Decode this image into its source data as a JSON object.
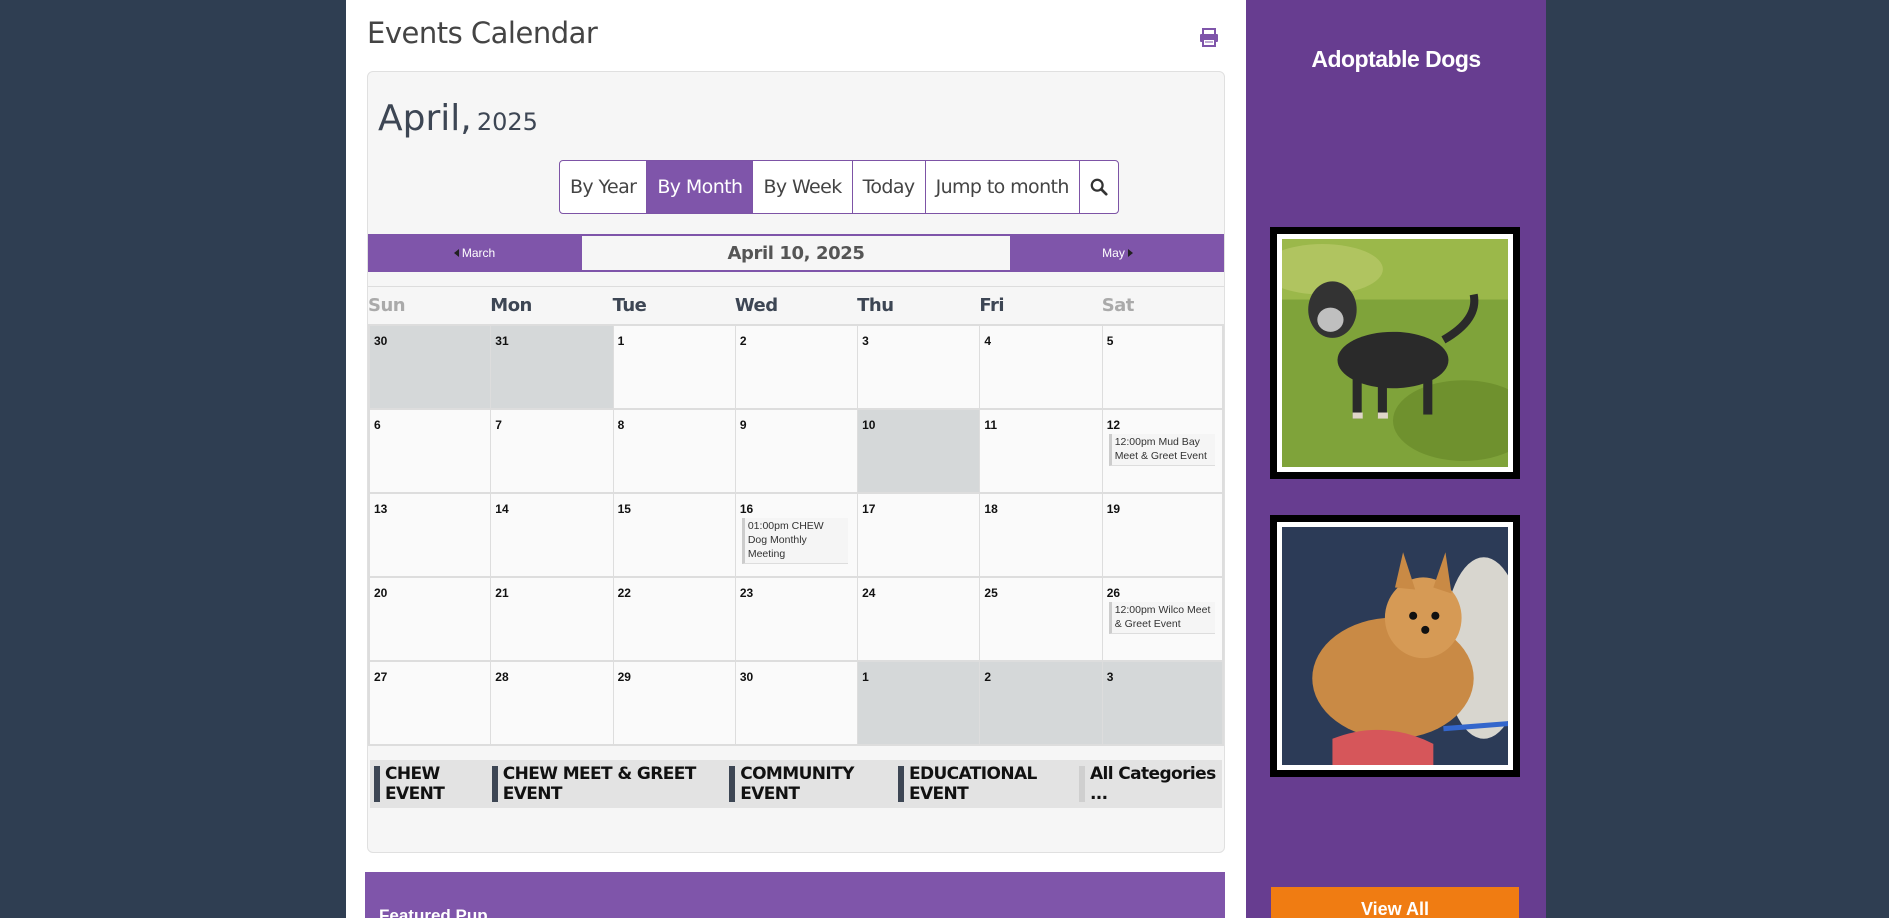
{
  "page": {
    "title": "Events Calendar"
  },
  "calendar": {
    "month": "April,",
    "year": "2025",
    "view_buttons": [
      "By Year",
      "By Month",
      "By Week",
      "Today",
      "Jump to month"
    ],
    "active_view": "By Month",
    "nav": {
      "prev": "March",
      "current": "April 10, 2025",
      "next": "May"
    },
    "weekdays": [
      "Sun",
      "Mon",
      "Tue",
      "Wed",
      "Thu",
      "Fri",
      "Sat"
    ],
    "weeks": [
      [
        {
          "num": "30",
          "type": "other"
        },
        {
          "num": "31",
          "type": "other"
        },
        {
          "num": "1"
        },
        {
          "num": "2"
        },
        {
          "num": "3"
        },
        {
          "num": "4"
        },
        {
          "num": "5"
        }
      ],
      [
        {
          "num": "6"
        },
        {
          "num": "7"
        },
        {
          "num": "8"
        },
        {
          "num": "9"
        },
        {
          "num": "10",
          "type": "today"
        },
        {
          "num": "11"
        },
        {
          "num": "12",
          "events": [
            "12:00pm Mud Bay Meet & Greet Event"
          ]
        }
      ],
      [
        {
          "num": "13"
        },
        {
          "num": "14"
        },
        {
          "num": "15"
        },
        {
          "num": "16",
          "events": [
            "01:00pm CHEW Dog Monthly Meeting"
          ]
        },
        {
          "num": "17"
        },
        {
          "num": "18"
        },
        {
          "num": "19"
        }
      ],
      [
        {
          "num": "20"
        },
        {
          "num": "21"
        },
        {
          "num": "22"
        },
        {
          "num": "23"
        },
        {
          "num": "24"
        },
        {
          "num": "25"
        },
        {
          "num": "26",
          "events": [
            "12:00pm Wilco Meet & Greet Event"
          ]
        }
      ],
      [
        {
          "num": "27"
        },
        {
          "num": "28"
        },
        {
          "num": "29"
        },
        {
          "num": "30"
        },
        {
          "num": "1",
          "type": "other"
        },
        {
          "num": "2",
          "type": "other"
        },
        {
          "num": "3",
          "type": "other"
        }
      ]
    ],
    "legend": [
      {
        "label": "CHEW EVENT",
        "color": "#3d4654"
      },
      {
        "label": "CHEW MEET & GREET EVENT",
        "color": "#3d4654"
      },
      {
        "label": "COMMUNITY EVENT",
        "color": "#3d4654"
      },
      {
        "label": "EDUCATIONAL EVENT",
        "color": "#3d4654"
      },
      {
        "label": "All Categories ...",
        "color": "#cfcfcf"
      }
    ]
  },
  "featured": {
    "title": "Featured Pup"
  },
  "sidebar": {
    "title": "Adoptable Dogs",
    "view_all": "View All"
  },
  "colors": {
    "accent": "#7f55aa",
    "sidebar": "#673d90",
    "background": "#2f3e52",
    "cta": "#f07c12"
  }
}
